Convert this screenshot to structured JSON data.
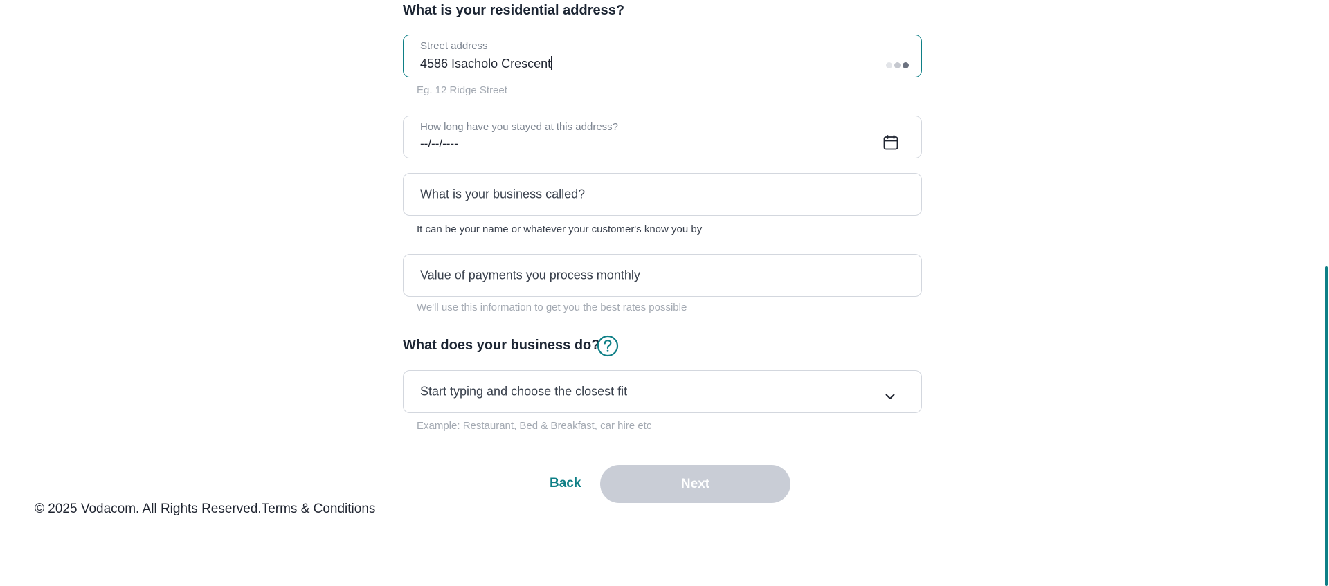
{
  "address": {
    "title": "What is your residential address?",
    "street_label": "Street address",
    "street_value": "4586 Isacholo Crescent",
    "street_helper": "Eg. 12 Ridge Street"
  },
  "duration": {
    "label": "How long have you stayed at this address?",
    "value": "--/--/----"
  },
  "business_name": {
    "placeholder": "What is your business called?",
    "helper": "It can be your name or whatever your customer's know you by"
  },
  "payments": {
    "placeholder": "Value of payments you process monthly",
    "helper": "We'll use this information to get you the best rates possible"
  },
  "business_type": {
    "title": "What does your business do?",
    "placeholder": "Start typing and choose the closest fit",
    "helper": "Example: Restaurant, Bed & Breakfast, car hire etc"
  },
  "actions": {
    "back_label": "Back",
    "next_label": "Next"
  },
  "footer": {
    "copyright": "© 2025 Vodacom. All Rights Reserved.",
    "terms_label": "Terms & Conditions"
  },
  "colors": {
    "accent": "#0e7f86",
    "disabled_button": "#c9cdd6"
  },
  "icons": {
    "calendar": "calendar-icon",
    "chevron": "chevron-down-icon",
    "help": "help-circle-icon",
    "loader": "loading-dots-icon"
  }
}
